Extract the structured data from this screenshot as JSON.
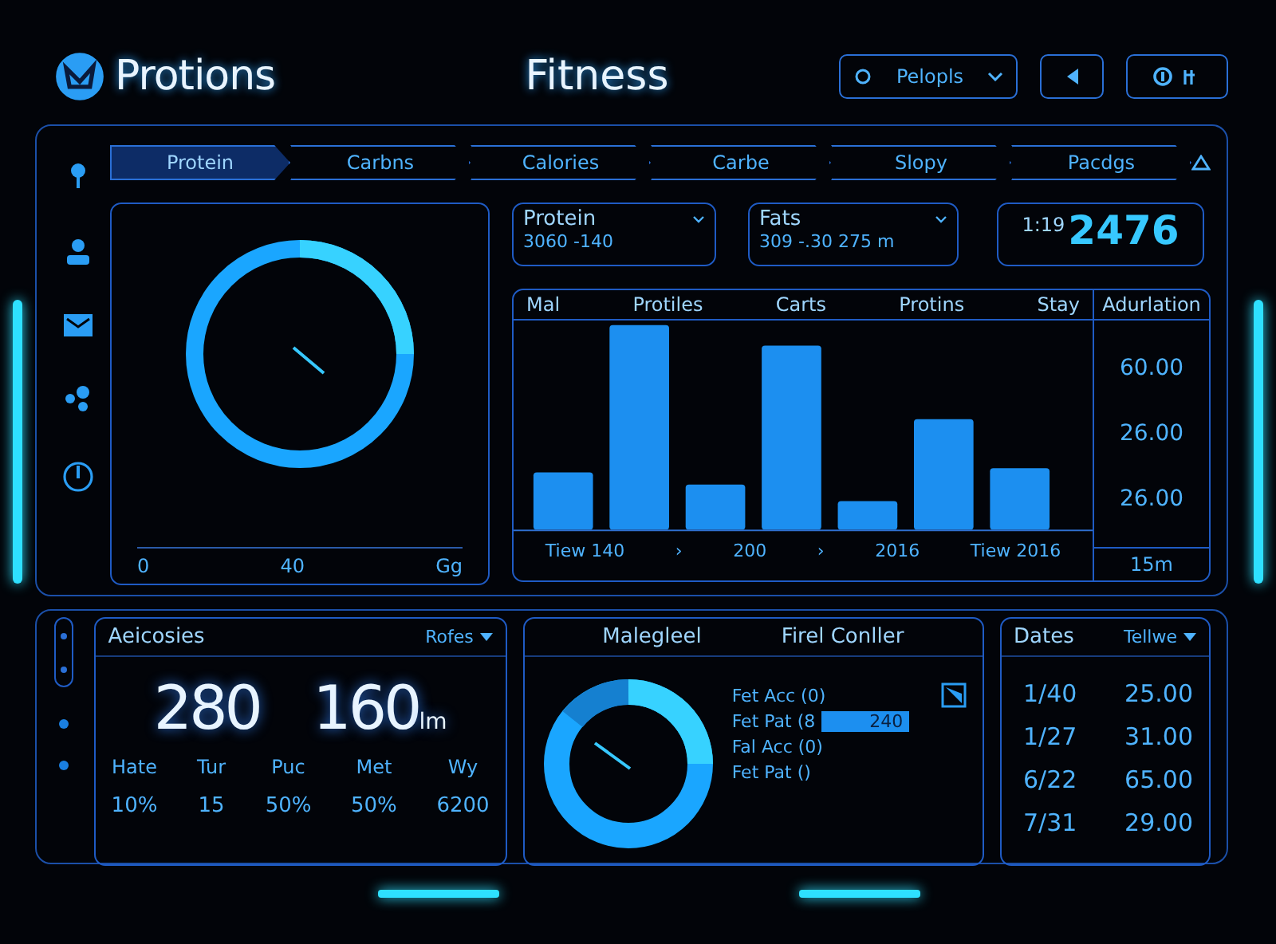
{
  "header": {
    "logo_text": "Protions",
    "title": "Fitness",
    "profile": {
      "label": "Pelopls"
    }
  },
  "steps": [
    {
      "label": "Protein",
      "selected": true
    },
    {
      "label": "Carbns",
      "selected": false
    },
    {
      "label": "Calories",
      "selected": false
    },
    {
      "label": "Carbe",
      "selected": false
    },
    {
      "label": "Slopy",
      "selected": false
    },
    {
      "label": "Pacdgs",
      "selected": false
    }
  ],
  "gauge": {
    "axis_labels": [
      "0",
      "40",
      "Gg"
    ]
  },
  "metrics": [
    {
      "title": "Protein",
      "value": "3060 -140"
    },
    {
      "title": "Fats",
      "value": "309 -.30 275 m"
    }
  ],
  "counter": {
    "prefix": "1:19",
    "value": "2476"
  },
  "chart_table": {
    "columns": [
      "Mal",
      "Protiles",
      "Carts",
      "Protins",
      "Stay"
    ],
    "footer": [
      "Tiew 140",
      "›",
      "200",
      "›",
      "2016",
      "Tiew 2016"
    ],
    "side_header": "Adurlation",
    "side_values": [
      "60.00",
      "26.00",
      "26.00"
    ],
    "side_footer": "15m"
  },
  "activities": {
    "title": "Aeicosies",
    "filter": "Rofes",
    "big_values": [
      {
        "value": "280"
      },
      {
        "value": "160",
        "unit": "lm"
      }
    ],
    "stats": [
      {
        "label": "Hate",
        "value": "10%"
      },
      {
        "label": "Tur",
        "value": "15"
      },
      {
        "label": "Puc",
        "value": "50%"
      },
      {
        "label": "Met",
        "value": "50%"
      },
      {
        "label": "Wy",
        "value": "6200"
      }
    ]
  },
  "breakdown": {
    "titles": [
      "Malegleel",
      "Firel Conller"
    ],
    "legend": [
      {
        "label": "Fet Acc (0)"
      },
      {
        "label": "Fet Pat (8",
        "badge": "240"
      },
      {
        "label": "Fal Acc (0)"
      },
      {
        "label": "Fet Pat ()"
      }
    ]
  },
  "dates": {
    "title": "Dates",
    "filter": "Tellwe",
    "rows": [
      [
        "1/40",
        "25.00"
      ],
      [
        "1/27",
        "31.00"
      ],
      [
        "6/22",
        "65.00"
      ],
      [
        "7/31",
        "29.00"
      ]
    ]
  }
}
